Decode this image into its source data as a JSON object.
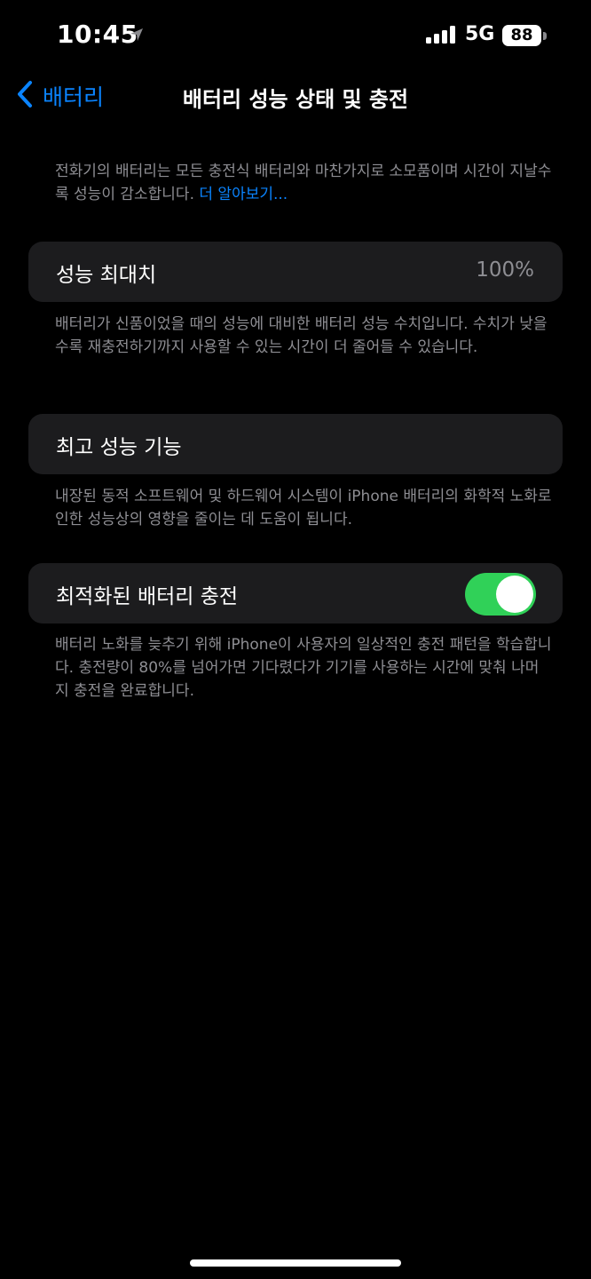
{
  "status_bar": {
    "time": "10:45",
    "network": "5G",
    "battery_level": "88",
    "icons": [
      "location-arrow-icon",
      "cellular-signal-icon",
      "battery-icon"
    ]
  },
  "nav": {
    "back_label": "배터리",
    "title": "배터리 성능 상태 및 충전"
  },
  "intro": {
    "text": "전화기의 배터리는 모든 충전식 배터리와 마찬가지로 소모품이며 시간이 지날수록 성능이 감소합니다.",
    "link": "더 알아보기..."
  },
  "maximum_capacity": {
    "label": "성능 최대치",
    "value": "100%",
    "description": "배터리가 신품이었을 때의 성능에 대비한 배터리 성능 수치입니다. 수치가 낮을수록 재충전하기까지 사용할 수 있는 시간이 더 줄어들 수 있습니다."
  },
  "peak_performance": {
    "label": "최고 성능 기능",
    "description": "내장된 동적 소프트웨어 및 하드웨어 시스템이 iPhone 배터리의 화학적 노화로 인한 성능상의 영향을 줄이는 데 도움이 됩니다."
  },
  "optimized_charging": {
    "label": "최적화된 배터리 충전",
    "enabled": true,
    "description": "배터리 노화를 늦추기 위해 iPhone이 사용자의 일상적인 충전 패턴을 학습합니다. 충전량이 80%를 넘어가면 기다렸다가 기기를 사용하는 시간에 맞춰 나머지 충전을 완료합니다."
  },
  "colors": {
    "background": "#000000",
    "cell": "#1c1c1e",
    "accent": "#0a84ff",
    "toggle_on": "#30d158",
    "secondary_text": "#8e8e93"
  }
}
